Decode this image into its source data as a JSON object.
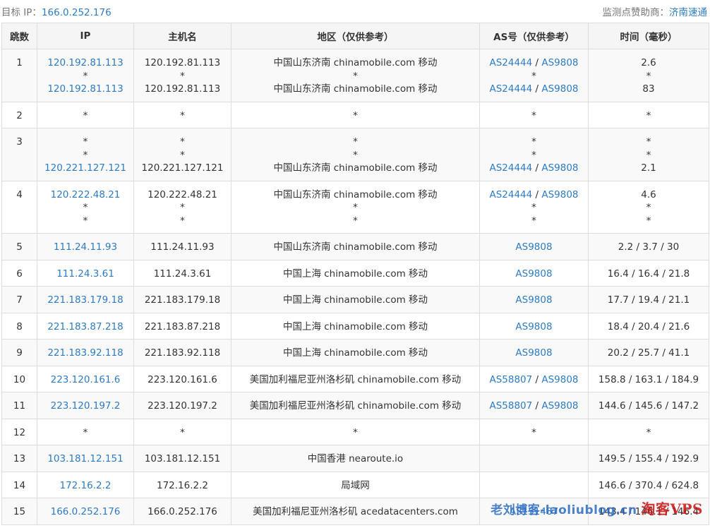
{
  "header": {
    "target_label": "目标 IP：",
    "target_ip": "166.0.252.176",
    "sponsor_label": "监测点赞助商：",
    "sponsor_name": "济南速通"
  },
  "columns": [
    "跳数",
    "IP",
    "主机名",
    "地区（仅供参考）",
    "AS号（仅供参考）",
    "时间（毫秒）"
  ],
  "rows": [
    {
      "hop": "1",
      "lines": [
        {
          "ip": "120.192.81.113",
          "host": "120.192.81.113",
          "region": "中国山东济南 chinamobile.com 移动",
          "as": [
            "AS24444",
            "AS9808"
          ],
          "time": "2.6"
        },
        {
          "ip": "*",
          "host": "*",
          "region": "*",
          "as": [
            "*"
          ],
          "time": "*"
        },
        {
          "ip": "120.192.81.113",
          "host": "120.192.81.113",
          "region": "中国山东济南 chinamobile.com 移动",
          "as": [
            "AS24444",
            "AS9808"
          ],
          "time": "83"
        }
      ]
    },
    {
      "hop": "2",
      "lines": [
        {
          "ip": "*",
          "host": "*",
          "region": "*",
          "as": [
            "*"
          ],
          "time": "*"
        }
      ]
    },
    {
      "hop": "3",
      "lines": [
        {
          "ip": "*",
          "host": "*",
          "region": "*",
          "as": [
            "*"
          ],
          "time": "*"
        },
        {
          "ip": "*",
          "host": "*",
          "region": "*",
          "as": [
            "*"
          ],
          "time": "*"
        },
        {
          "ip": "120.221.127.121",
          "host": "120.221.127.121",
          "region": "中国山东济南 chinamobile.com 移动",
          "as": [
            "AS24444",
            "AS9808"
          ],
          "time": "2.1"
        }
      ]
    },
    {
      "hop": "4",
      "lines": [
        {
          "ip": "120.222.48.21",
          "host": "120.222.48.21",
          "region": "中国山东济南 chinamobile.com 移动",
          "as": [
            "AS24444",
            "AS9808"
          ],
          "time": "4.6"
        },
        {
          "ip": "*",
          "host": "*",
          "region": "*",
          "as": [
            "*"
          ],
          "time": "*"
        },
        {
          "ip": "*",
          "host": "*",
          "region": "*",
          "as": [
            "*"
          ],
          "time": "*"
        }
      ]
    },
    {
      "hop": "5",
      "lines": [
        {
          "ip": "111.24.11.93",
          "host": "111.24.11.93",
          "region": "中国山东济南 chinamobile.com 移动",
          "as": [
            "AS9808"
          ],
          "time": "2.2 / 3.7 / 30"
        }
      ]
    },
    {
      "hop": "6",
      "lines": [
        {
          "ip": "111.24.3.61",
          "host": "111.24.3.61",
          "region": "中国上海 chinamobile.com 移动",
          "as": [
            "AS9808"
          ],
          "time": "16.4 / 16.4 / 21.8"
        }
      ]
    },
    {
      "hop": "7",
      "lines": [
        {
          "ip": "221.183.179.18",
          "host": "221.183.179.18",
          "region": "中国上海 chinamobile.com 移动",
          "as": [
            "AS9808"
          ],
          "time": "17.7 / 19.4 / 21.1"
        }
      ]
    },
    {
      "hop": "8",
      "lines": [
        {
          "ip": "221.183.87.218",
          "host": "221.183.87.218",
          "region": "中国上海 chinamobile.com 移动",
          "as": [
            "AS9808"
          ],
          "time": "18.4 / 20.4 / 21.6"
        }
      ]
    },
    {
      "hop": "9",
      "lines": [
        {
          "ip": "221.183.92.118",
          "host": "221.183.92.118",
          "region": "中国上海 chinamobile.com 移动",
          "as": [
            "AS9808"
          ],
          "time": "20.2 / 25.7 / 41.1"
        }
      ]
    },
    {
      "hop": "10",
      "lines": [
        {
          "ip": "223.120.161.6",
          "host": "223.120.161.6",
          "region": "美国加利福尼亚州洛杉矶 chinamobile.com 移动",
          "as": [
            "AS58807",
            "AS9808"
          ],
          "time": "158.8 / 163.1 / 184.9"
        }
      ]
    },
    {
      "hop": "11",
      "lines": [
        {
          "ip": "223.120.197.2",
          "host": "223.120.197.2",
          "region": "美国加利福尼亚州洛杉矶 chinamobile.com 移动",
          "as": [
            "AS58807",
            "AS9808"
          ],
          "time": "144.6 / 145.6 / 147.2"
        }
      ]
    },
    {
      "hop": "12",
      "lines": [
        {
          "ip": "*",
          "host": "*",
          "region": "*",
          "as": [
            "*"
          ],
          "time": "*"
        }
      ]
    },
    {
      "hop": "13",
      "lines": [
        {
          "ip": "103.181.12.151",
          "host": "103.181.12.151",
          "region": "中国香港 nearoute.io",
          "as": [],
          "time": "149.5 / 155.4 / 192.9"
        }
      ]
    },
    {
      "hop": "14",
      "lines": [
        {
          "ip": "172.16.2.2",
          "host": "172.16.2.2",
          "region": "局域网",
          "as": [],
          "time": "146.6 / 370.4 / 624.8"
        }
      ]
    },
    {
      "hop": "15",
      "lines": [
        {
          "ip": "166.0.252.176",
          "host": "166.0.252.176",
          "region": "美国加利福尼亚州洛杉矶 acedatacenters.com",
          "as": [
            "AS151487"
          ],
          "time": "143.4 / 146.1 / 146.4"
        }
      ]
    }
  ],
  "watermark": {
    "blue": "老刘博客-laoliublog.cn",
    "red": "淘客VPS"
  },
  "colors": {
    "link": "#2d7bc4",
    "header_bg": "#f5f5f5",
    "alt_row_bg": "#f9f9f9",
    "border": "#dddddd",
    "watermark_red": "#cc1111"
  }
}
